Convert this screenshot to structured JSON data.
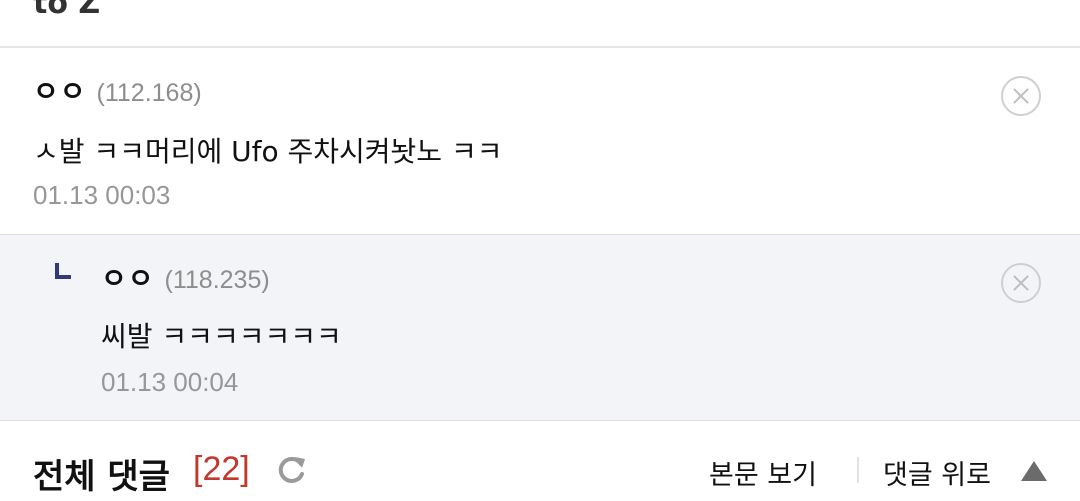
{
  "top": {
    "cut_text": "to Z"
  },
  "comments": [
    {
      "nick": "ㅇㅇ",
      "ip": "(112.168)",
      "text": "ㅅ발 ㅋㅋ머리에 Ufo 주차시켜놧노 ㅋㅋ",
      "date": "01.13 00:03",
      "delete_icon": "close-circle-icon"
    },
    {
      "nick": "ㅇㅇ",
      "ip": "(118.235)",
      "text": "씨발 ㅋㅋㅋㅋㅋㅋㅋ",
      "date": "01.13 00:04",
      "reply_icon": "reply-corner-icon",
      "delete_icon": "close-circle-icon"
    }
  ],
  "footer": {
    "title": "전체 댓글",
    "count": "[22]",
    "refresh_icon": "refresh-icon",
    "view_post": "본문 보기",
    "to_top": "댓글 위로",
    "to_top_icon": "triangle-up-icon"
  },
  "colors": {
    "count": "#c0392b",
    "reply_bg": "#f3f4f8",
    "reply_icon": "#2f3a7a",
    "meta": "#8d8d8d"
  }
}
